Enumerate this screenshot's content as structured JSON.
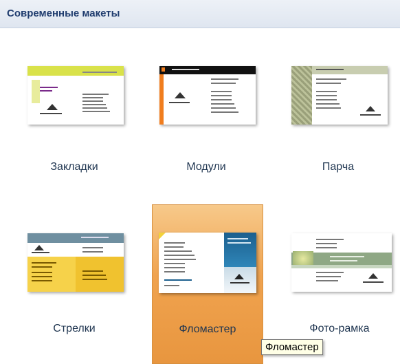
{
  "gallery": {
    "section_title": "Современные макеты",
    "items": [
      {
        "label": "Закладки"
      },
      {
        "label": "Модули"
      },
      {
        "label": "Парча"
      },
      {
        "label": "Стрелки"
      },
      {
        "label": "Фломастер",
        "selected": true
      },
      {
        "label": "Фото-рамка"
      }
    ]
  },
  "tooltip": "Фломастер"
}
